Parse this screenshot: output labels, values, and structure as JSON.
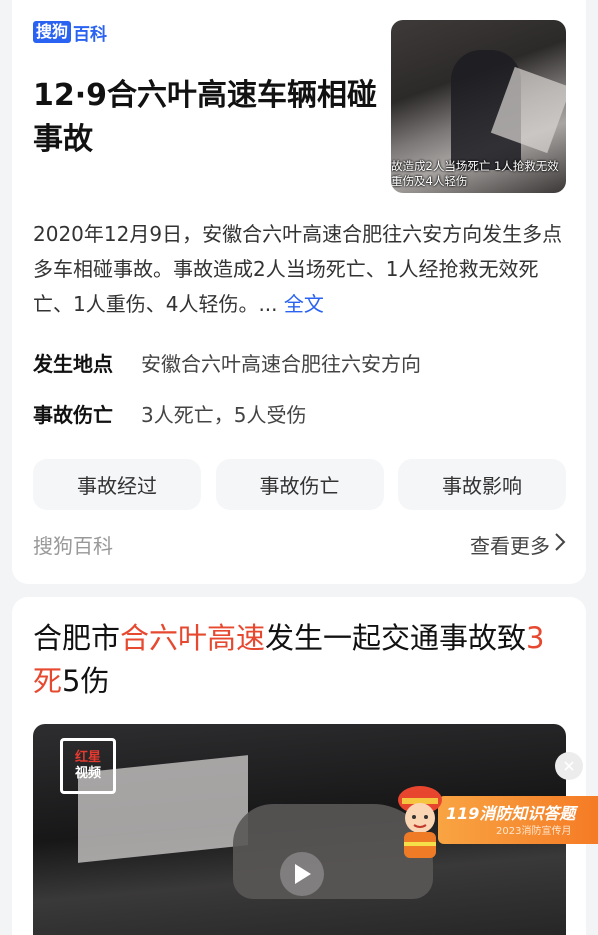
{
  "card1": {
    "brand_box": "搜狗",
    "brand_text": "百科",
    "title": "12·9合六叶高速车辆相碰事故",
    "thumb_caption_line1": "故造成2人当场死亡 1人抢救无效",
    "thumb_caption_line2": "重伤及4人轻伤",
    "summary": "2020年12月9日，安徽合六叶高速合肥往六安方向发生多点多车相碰事故。事故造成2人当场死亡、1人经抢救无效死亡、1人重伤、4人轻伤。... ",
    "summary_more": "全文",
    "location_label": "发生地点",
    "location_value": "安徽合六叶高速合肥往六安方向",
    "casualties_label": "事故伤亡",
    "casualties_value": "3人死亡，5人受伤",
    "tabs": [
      {
        "label": "事故经过"
      },
      {
        "label": "事故伤亡"
      },
      {
        "label": "事故影响"
      }
    ],
    "source": "搜狗百科",
    "view_more": "查看更多"
  },
  "card2": {
    "headline_part1": "合肥市",
    "headline_hl1": "合六叶高速",
    "headline_part2": "发生一起交通事故致",
    "headline_hl2": "3死",
    "headline_part3": "5伤",
    "video_logo_line1": "红星",
    "video_logo_line2": "视频"
  },
  "banner": {
    "title": "119消防知识答题",
    "subtitle": "2023消防宣传月"
  },
  "colors": {
    "accent_blue": "#2a63f2",
    "highlight_red": "#e6492f",
    "banner_orange": "#f57b25"
  }
}
